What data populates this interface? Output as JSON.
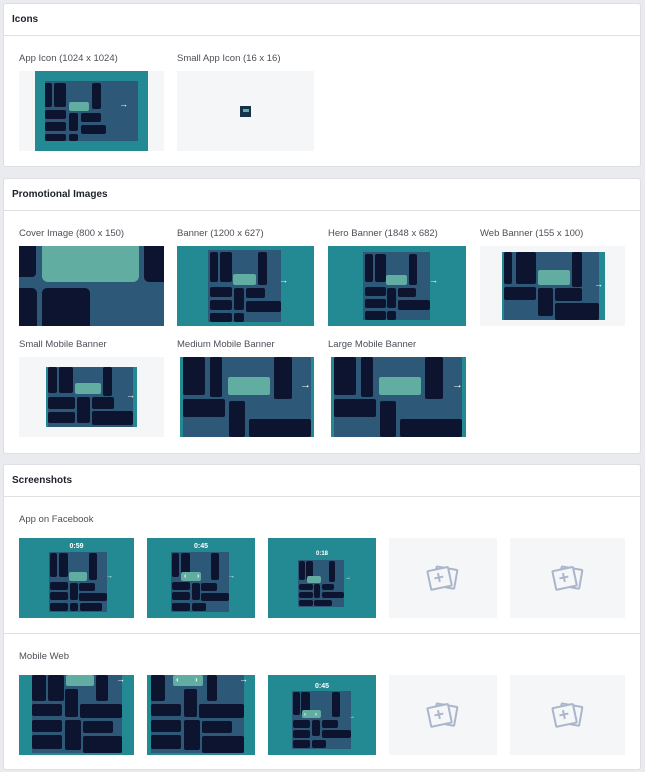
{
  "colors": {
    "teal": "#238a94",
    "board": "#2d5878",
    "block": "#0d1430",
    "goal": "#62ada1",
    "placeholder": "#f5f6f7"
  },
  "icons": {
    "title": "Icons",
    "items": [
      {
        "label": "App Icon (1024 x 1024)"
      },
      {
        "label": "Small App Icon (16 x 16)"
      }
    ]
  },
  "promo": {
    "title": "Promotional Images",
    "items": [
      {
        "label": "Cover Image (800 x 150)"
      },
      {
        "label": "Banner (1200 x 627)"
      },
      {
        "label": "Hero Banner (1848 x 682)"
      },
      {
        "label": "Web Banner (155 x 100)"
      },
      {
        "label": "Small Mobile Banner"
      },
      {
        "label": "Medium Mobile Banner"
      },
      {
        "label": "Large Mobile Banner"
      }
    ]
  },
  "screens": {
    "title": "Screenshots",
    "facebook": {
      "label": "App on Facebook",
      "timers": [
        "0:59",
        "0:45",
        "0:18"
      ],
      "placeholders": 2
    },
    "mobile": {
      "label": "Mobile Web",
      "timers": [
        "0:45"
      ],
      "placeholders": 2
    }
  },
  "glyphs": {
    "arrow": "→",
    "left": "‹",
    "right": "›"
  }
}
